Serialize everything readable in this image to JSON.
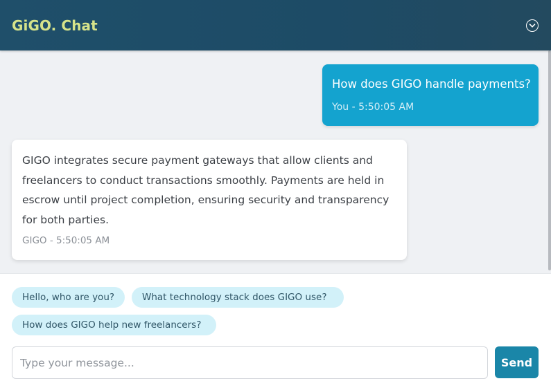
{
  "header": {
    "title": "GiGO. Chat",
    "collapse_icon": "chevron-down-circle-icon"
  },
  "messages": [
    {
      "sender": "user",
      "text": "How does GIGO handle payments?",
      "meta": "You - 5:50:05 AM"
    },
    {
      "sender": "bot",
      "text": "GIGO integrates secure payment gateways that allow clients and freelancers to conduct transactions smoothly. Payments are held in escrow until project completion, ensuring security and transparency for both parties.",
      "meta": "GIGO - 5:50:05 AM"
    }
  ],
  "suggestions": [
    "Hello, who are you?",
    "What technology stack does GIGO use?",
    "How does GIGO help new freelancers?"
  ],
  "composer": {
    "placeholder": "Type your message...",
    "value": "",
    "send_label": "Send"
  },
  "colors": {
    "header_bg": "#1f4f6a",
    "brand": "#d6e38a",
    "user_bubble": "#14a3cf",
    "chip_bg": "#d2f1f9",
    "send_button": "#1a86a8"
  }
}
